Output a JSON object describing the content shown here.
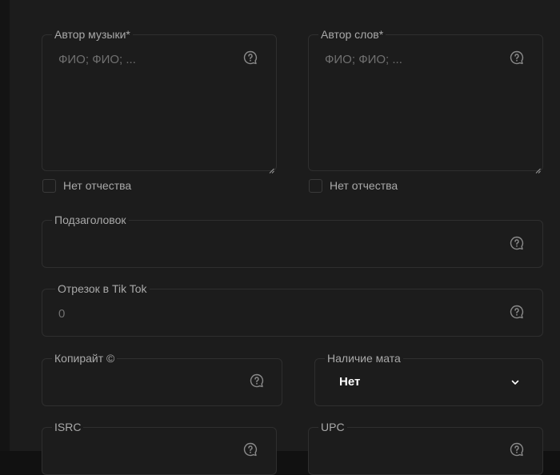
{
  "form": {
    "music_author": {
      "label": "Автор музыки*",
      "placeholder": "ФИО; ФИО; ..."
    },
    "lyrics_author": {
      "label": "Автор слов*",
      "placeholder": "ФИО; ФИО; ..."
    },
    "no_patronymic_music": {
      "label": "Нет отчества"
    },
    "no_patronymic_lyrics": {
      "label": "Нет отчества"
    },
    "subtitle": {
      "label": "Подзаголовок"
    },
    "tiktok_segment": {
      "label": "Отрезок в Tik Tok",
      "placeholder": "0"
    },
    "copyright": {
      "label": "Копирайт ©"
    },
    "explicit": {
      "label": "Наличие мата",
      "value": "Нет"
    },
    "isrc": {
      "label": "ISRC"
    },
    "upc": {
      "label": "UPC"
    }
  },
  "icons": {
    "help": "question-bubble-icon",
    "dropdown": "chevron-down-icon",
    "resize": "resize-grip-icon"
  },
  "colors": {
    "background": "#1c1c1c",
    "border": "#2f2f2f",
    "label": "#a9a9a9",
    "placeholder": "#707070",
    "value": "#ffffff"
  }
}
